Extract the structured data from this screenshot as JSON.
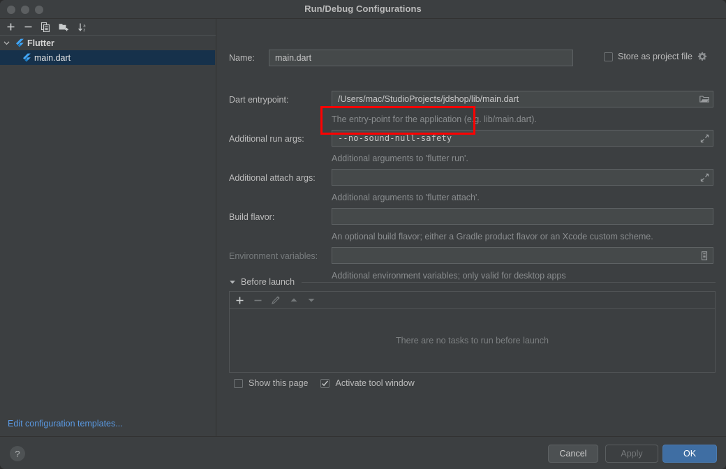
{
  "window": {
    "title": "Run/Debug Configurations",
    "traffic_lights": [
      "close",
      "minimize",
      "zoom"
    ]
  },
  "sidebar": {
    "toolbar": [
      {
        "name": "add-configuration-button",
        "icon": "plus-icon",
        "label": "+"
      },
      {
        "name": "remove-configuration-button",
        "icon": "minus-icon",
        "label": "−"
      },
      {
        "name": "copy-configuration-button",
        "icon": "copy-icon",
        "label": "Copy"
      },
      {
        "name": "new-folder-button",
        "icon": "folder-add-icon",
        "label": "New Folder"
      },
      {
        "name": "sort-configurations-button",
        "icon": "sort-alpha-icon",
        "label": "Sort"
      }
    ],
    "tree": [
      {
        "label": "Flutter",
        "type": "group",
        "expanded": true,
        "selected": false,
        "icon": "flutter-icon"
      },
      {
        "label": "main.dart",
        "type": "item",
        "expanded": false,
        "selected": true,
        "icon": "flutter-icon"
      }
    ],
    "edit_templates_link": "Edit configuration templates..."
  },
  "form": {
    "name_label": "Name:",
    "name_value": "main.dart",
    "store_as_project_file_label": "Store as project file",
    "store_as_project_file_checked": false,
    "store_gear_icon": "gear-icon",
    "fields": [
      {
        "label": "Dart entrypoint:",
        "value": "/Users/mac/StudioProjects/jdshop/lib/main.dart",
        "hint": "The entry-point for the application (e.g. lib/main.dart).",
        "button_icon": "folder-icon",
        "mono": false,
        "dim_label": false
      },
      {
        "label": "Additional run args:",
        "value": "--no-sound-null-safety",
        "hint": "Additional arguments to 'flutter run'.",
        "button_icon": "expand-icon",
        "mono": true,
        "dim_label": false
      },
      {
        "label": "Additional attach args:",
        "value": "",
        "hint": "Additional arguments to 'flutter attach'.",
        "button_icon": "expand-icon",
        "mono": true,
        "dim_label": false
      },
      {
        "label": "Build flavor:",
        "value": "",
        "hint": "An optional build flavor; either a Gradle product flavor or an Xcode custom scheme.",
        "button_icon": "",
        "mono": false,
        "dim_label": false
      },
      {
        "label": "Environment variables:",
        "value": "",
        "hint": "Additional environment variables; only valid for desktop apps",
        "button_icon": "list-icon",
        "mono": false,
        "dim_label": true
      }
    ]
  },
  "before_launch": {
    "title": "Before launch",
    "expanded": true,
    "toolbar": [
      {
        "name": "add-task-button",
        "icon": "plus-icon",
        "enabled": true
      },
      {
        "name": "remove-task-button",
        "icon": "minus-icon",
        "enabled": false
      },
      {
        "name": "edit-task-button",
        "icon": "pencil-icon",
        "enabled": false
      },
      {
        "name": "move-up-button",
        "icon": "triangle-up-icon",
        "enabled": false
      },
      {
        "name": "move-down-button",
        "icon": "triangle-down-icon",
        "enabled": false
      }
    ],
    "empty_text": "There are no tasks to run before launch",
    "show_this_page_label": "Show this page",
    "show_this_page_checked": false,
    "activate_tool_window_label": "Activate tool window",
    "activate_tool_window_checked": true
  },
  "footer": {
    "help_label": "?",
    "cancel_label": "Cancel",
    "apply_label": "Apply",
    "apply_enabled": false,
    "ok_label": "OK"
  },
  "annotation": {
    "highlight_color": "#ff0000",
    "highlights": [
      "additional-run-args-field"
    ]
  },
  "colors": {
    "window_bg": "#3c3f41",
    "field_bg": "#45494a",
    "selection_bg": "#16314b",
    "link": "#5a9ae4",
    "ok_button": "#3f6ea3",
    "flutter_blue": "#40b0e8",
    "annotation_red": "#ff0000"
  }
}
